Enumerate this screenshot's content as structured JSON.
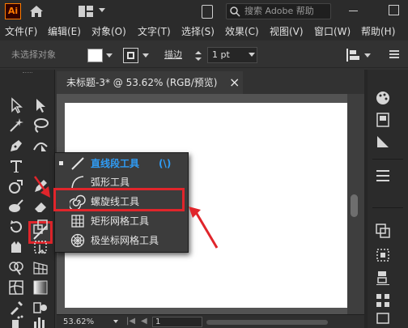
{
  "app": {
    "logo": "Ai",
    "search_placeholder": "搜索 Adobe 帮助"
  },
  "menu": [
    {
      "label": "文件(F)"
    },
    {
      "label": "编辑(E)"
    },
    {
      "label": "对象(O)"
    },
    {
      "label": "文字(T)"
    },
    {
      "label": "选择(S)"
    },
    {
      "label": "效果(C)"
    },
    {
      "label": "视图(V)"
    },
    {
      "label": "窗口(W)"
    },
    {
      "label": "帮助(H)"
    }
  ],
  "control_bar": {
    "selection_status": "未选择对象",
    "stroke_label": "描边",
    "stroke_value": "1 pt"
  },
  "document": {
    "tab_title": "未标题-3* @ 53.62% (RGB/预览)",
    "close_glyph": "×"
  },
  "status_bar": {
    "zoom": "53.62%",
    "page": "1"
  },
  "flyout": {
    "items": [
      {
        "label": "直线段工具",
        "shortcut": "(\\)",
        "icon": "line-segment-icon",
        "active": true
      },
      {
        "label": "弧形工具",
        "icon": "arc-icon"
      },
      {
        "label": "螺旋线工具",
        "icon": "spiral-icon",
        "highlighted": true
      },
      {
        "label": "矩形网格工具",
        "icon": "rectangular-grid-icon"
      },
      {
        "label": "极坐标网格工具",
        "icon": "polar-grid-icon"
      }
    ]
  },
  "colors": {
    "highlight": "#e0252b",
    "active_tool_text": "#2f9cf5",
    "brand": "#ff7c00"
  }
}
